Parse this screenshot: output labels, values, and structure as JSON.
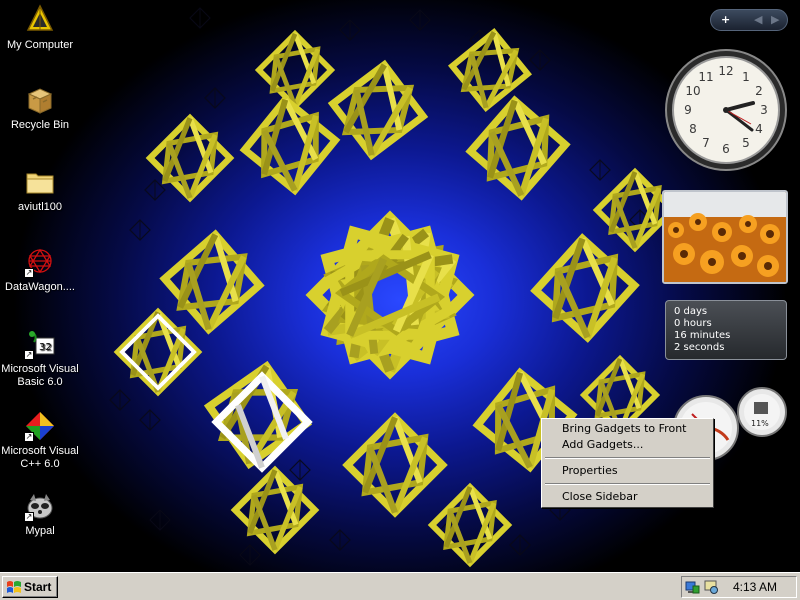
{
  "desktop": {
    "icons": [
      {
        "label": "My Computer",
        "icon": "my-computer-icon"
      },
      {
        "label": "Recycle Bin",
        "icon": "recycle-bin-icon"
      },
      {
        "label": "aviutl100",
        "icon": "folder-icon"
      },
      {
        "label": "DataWagon....",
        "icon": "datawagon-shortcut-icon"
      },
      {
        "label": "Microsoft Visual Basic 6.0",
        "icon": "visual-basic-shortcut-icon"
      },
      {
        "label": "Microsoft Visual C++ 6.0",
        "icon": "visual-cpp-shortcut-icon"
      },
      {
        "label": "Mypal",
        "icon": "mypal-shortcut-icon"
      }
    ],
    "wallpaper": {
      "icon": "octahedra-wallpaper",
      "colors": {
        "center": "#2a48ff",
        "edge": "#000000",
        "shapes": "#d4cc2a"
      }
    }
  },
  "sidebar": {
    "controls": {
      "add": "+",
      "prev": "◀",
      "next": "▶"
    },
    "clock": {
      "numbers": [
        "12",
        "1",
        "2",
        "3",
        "4",
        "5",
        "6",
        "7",
        "8",
        "9",
        "10",
        "11"
      ]
    },
    "uptime": {
      "days": "0 days",
      "hours": "0 hours",
      "minutes": "16 minutes",
      "seconds": "2 seconds"
    },
    "meter": {
      "percent": "11%"
    }
  },
  "context_menu": {
    "items": [
      "Bring Gadgets to Front",
      "Add Gadgets...",
      "Properties",
      "Close Sidebar"
    ]
  },
  "taskbar": {
    "start_label": "Start",
    "clock": "4:13 AM"
  }
}
